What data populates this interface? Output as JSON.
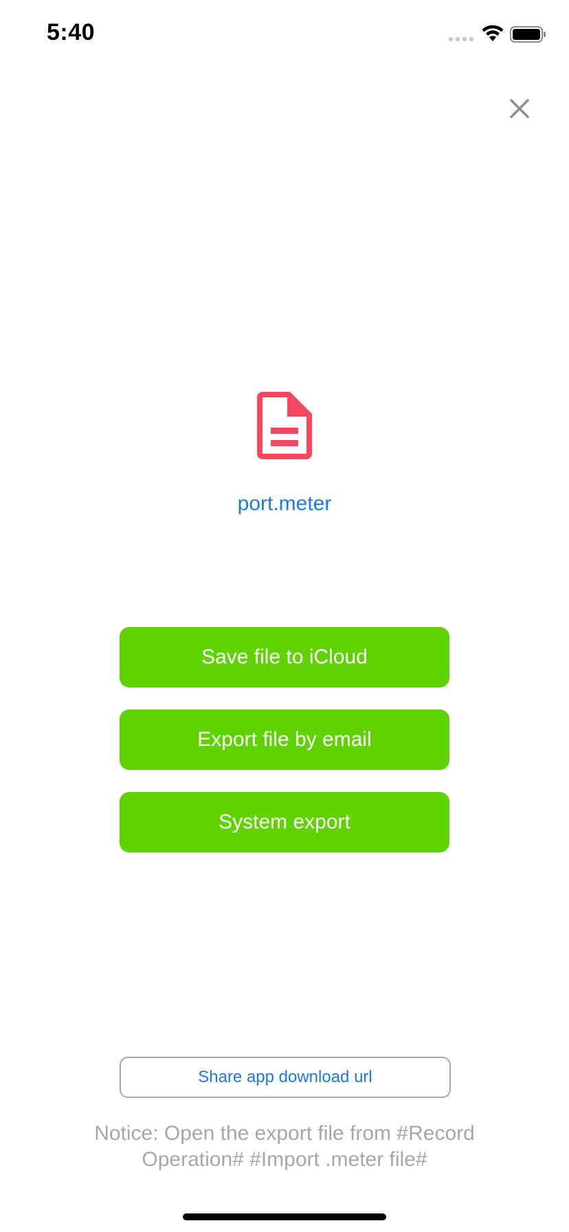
{
  "status_bar": {
    "time": "5:40",
    "signal_icon": "cellular-signal-icon",
    "wifi_icon": "wifi-icon",
    "battery_icon": "battery-icon"
  },
  "close_icon": "close-icon",
  "file": {
    "icon": "document-icon",
    "icon_color": "#f2495f",
    "name": "port.meter"
  },
  "actions": {
    "save_icloud": "Save file to iCloud",
    "export_email": "Export file by email",
    "system_export": "System export"
  },
  "share": {
    "label": "Share app download url"
  },
  "notice": "Notice: Open the export file from #Record Operation# #Import .meter file#",
  "colors": {
    "accent_green": "#5fd300",
    "link_blue": "#1a7ae8",
    "notice_gray": "#a7a7a7"
  }
}
